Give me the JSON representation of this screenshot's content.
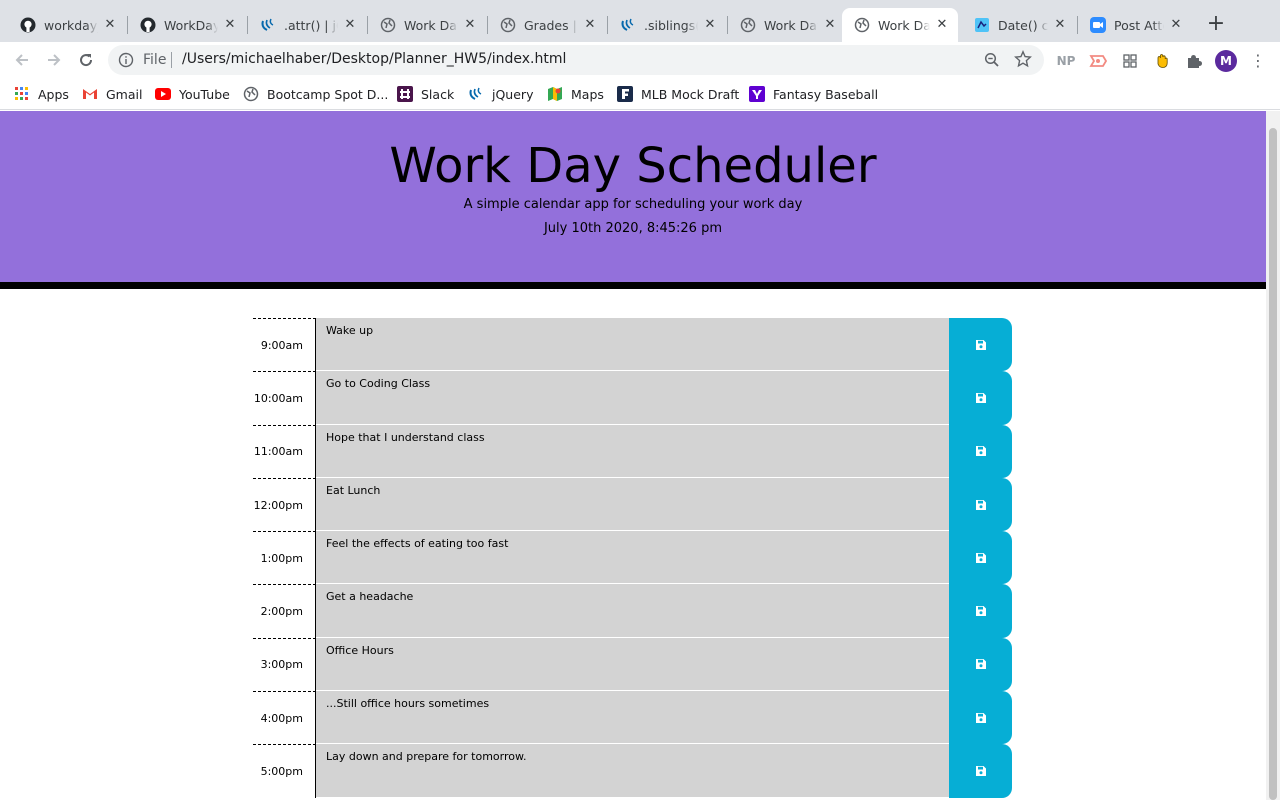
{
  "browser": {
    "tabs": [
      {
        "title": "workday_",
        "icon": "github-icon",
        "active": false
      },
      {
        "title": "WorkDayS",
        "icon": "github-icon",
        "active": false
      },
      {
        "title": ".attr() | jQ",
        "icon": "jquery-icon",
        "active": false
      },
      {
        "title": "Work Day",
        "icon": "globe-icon",
        "active": false
      },
      {
        "title": "Grades | B",
        "icon": "globe-icon",
        "active": false
      },
      {
        "title": ".siblings()",
        "icon": "jquery-icon",
        "active": false
      },
      {
        "title": "Work Day",
        "icon": "globe-icon",
        "active": false
      },
      {
        "title": "Work Day",
        "icon": "globe-icon",
        "active": true
      },
      {
        "title": "Date() co",
        "icon": "page-icon",
        "active": false
      },
      {
        "title": "Post Atte",
        "icon": "zoom-video-icon",
        "active": false
      }
    ],
    "omnibox": {
      "scheme": "File",
      "url": "/Users/michaelhaber/Desktop/Planner_HW5/index.html"
    },
    "extensions": [
      "NP",
      "cast-icon",
      "grid-icon",
      "hand-icon",
      "puzzle-icon"
    ],
    "profile_initial": "M",
    "bookmarks": [
      {
        "label": "Apps",
        "icon": "apps-grid-icon"
      },
      {
        "label": "Gmail",
        "icon": "gmail-icon"
      },
      {
        "label": "YouTube",
        "icon": "youtube-icon"
      },
      {
        "label": "Bootcamp Spot D...",
        "icon": "globe-icon"
      },
      {
        "label": "Slack",
        "icon": "slack-icon"
      },
      {
        "label": "jQuery",
        "icon": "jquery-icon"
      },
      {
        "label": "Maps",
        "icon": "maps-icon"
      },
      {
        "label": "MLB Mock Draft",
        "icon": "mlb-icon"
      },
      {
        "label": "Fantasy Baseball",
        "icon": "yahoo-icon"
      }
    ]
  },
  "page": {
    "title": "Work Day Scheduler",
    "lead": "A simple calendar app for scheduling your work day",
    "current_date": "July 10th 2020, 8:45:26 pm",
    "colors": {
      "header_bg": "#9370db",
      "row_bg": "#d3d3d3",
      "save_bg": "#06aed5"
    },
    "rows": [
      {
        "hour": "9:00am",
        "text": "Wake up"
      },
      {
        "hour": "10:00am",
        "text": "Go to Coding Class"
      },
      {
        "hour": "11:00am",
        "text": "Hope that I understand class"
      },
      {
        "hour": "12:00pm",
        "text": "Eat Lunch"
      },
      {
        "hour": "1:00pm",
        "text": "Feel the effects of eating too fast"
      },
      {
        "hour": "2:00pm",
        "text": "Get a headache"
      },
      {
        "hour": "3:00pm",
        "text": "Office Hours"
      },
      {
        "hour": "4:00pm",
        "text": "...Still office hours sometimes"
      },
      {
        "hour": "5:00pm",
        "text": "Lay down and prepare for tomorrow."
      }
    ]
  }
}
